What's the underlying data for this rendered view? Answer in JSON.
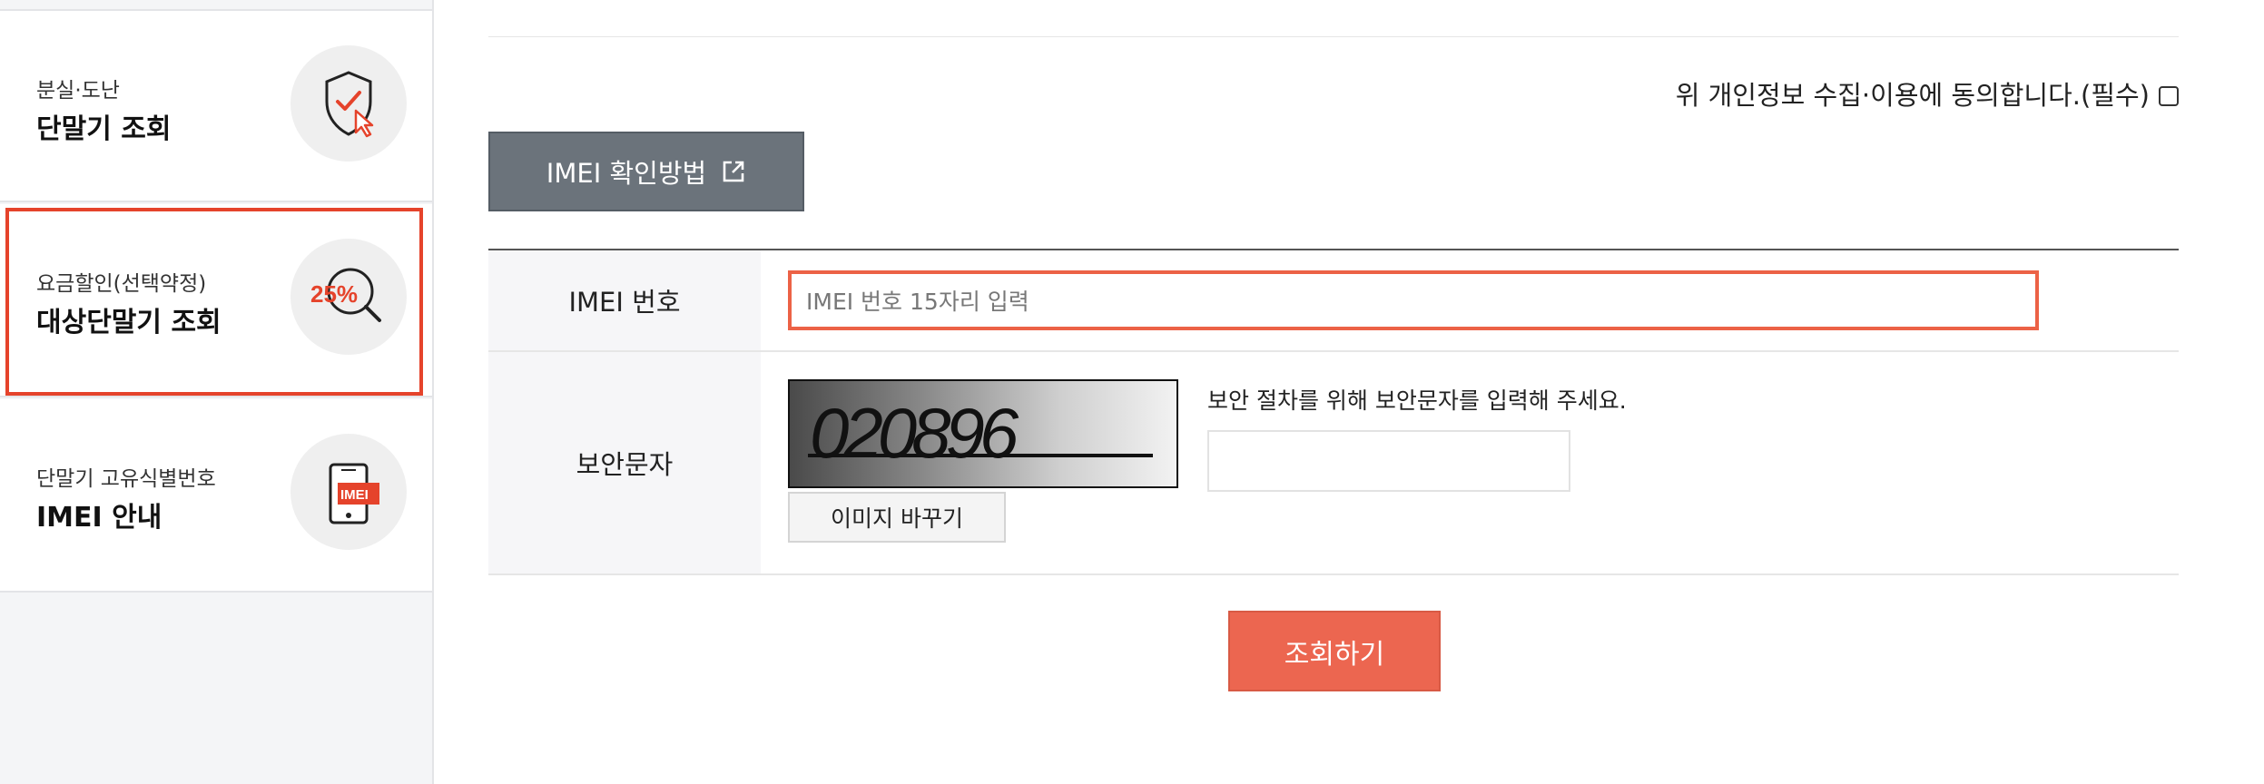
{
  "sidebar": {
    "items": [
      {
        "small": "분실·도난",
        "big": "단말기 조회",
        "icon": "shield-check-icon"
      },
      {
        "small": "요금할인(선택약정)",
        "big": "대상단말기 조회",
        "icon": "discount-search-icon",
        "badge": "25%",
        "active": true
      },
      {
        "small": "단말기 고유식별번호",
        "big": "IMEI 안내",
        "icon": "phone-imei-icon",
        "badge": "IMEI"
      }
    ]
  },
  "consent": {
    "label": "위 개인정보 수집·이용에 동의합니다.(필수)"
  },
  "imei_guide_button": {
    "label": "IMEI 확인방법"
  },
  "form": {
    "imei": {
      "label": "IMEI 번호",
      "placeholder": "IMEI 번호 15자리 입력"
    },
    "security": {
      "label": "보안문자",
      "captcha_text": "020896",
      "change_label": "이미지 바꾸기",
      "description": "보안 절차를 위해 보안문자를 입력해 주세요."
    }
  },
  "submit": {
    "label": "조회하기"
  },
  "colors": {
    "accent": "#ec6650",
    "active_border": "#e5432b",
    "dark_button": "#6b737b"
  }
}
